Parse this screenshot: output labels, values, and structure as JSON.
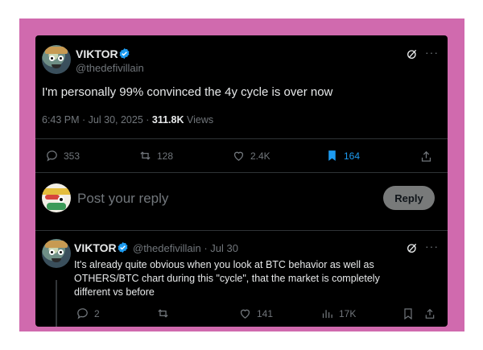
{
  "main_tweet": {
    "author_name": "VIKTOR",
    "author_handle": "@thedefivillain",
    "text": "I'm personally 99% convinced the 4y cycle is over now",
    "timestamp": "6:43 PM · Jul 30, 2025 · ",
    "views_count": "311.8K",
    "views_label": " Views",
    "actions": {
      "replies": "353",
      "reposts": "128",
      "likes": "2.4K",
      "bookmarks": "164"
    }
  },
  "reply_box": {
    "placeholder": "Post your reply",
    "button_label": "Reply"
  },
  "reply_tweet": {
    "author_name": "VIKTOR",
    "author_handle": "@thedefivillain · Jul 30",
    "text": "It's already quite obvious when you look at BTC behavior as well as OTHERS/BTC chart during this \"cycle\", that the market is completely different vs before",
    "actions": {
      "replies": "2",
      "reposts": "",
      "likes": "141",
      "views": "17K"
    }
  },
  "more_label": "···",
  "colors": {
    "background_frame": "#d06aae",
    "card": "#000000",
    "accent": "#1d9bf0",
    "muted": "#71767b"
  },
  "icons": [
    "grok-icon",
    "more-icon",
    "verified-icon",
    "reply-icon",
    "repost-icon",
    "like-icon",
    "bookmark-icon",
    "share-icon",
    "views-icon"
  ]
}
